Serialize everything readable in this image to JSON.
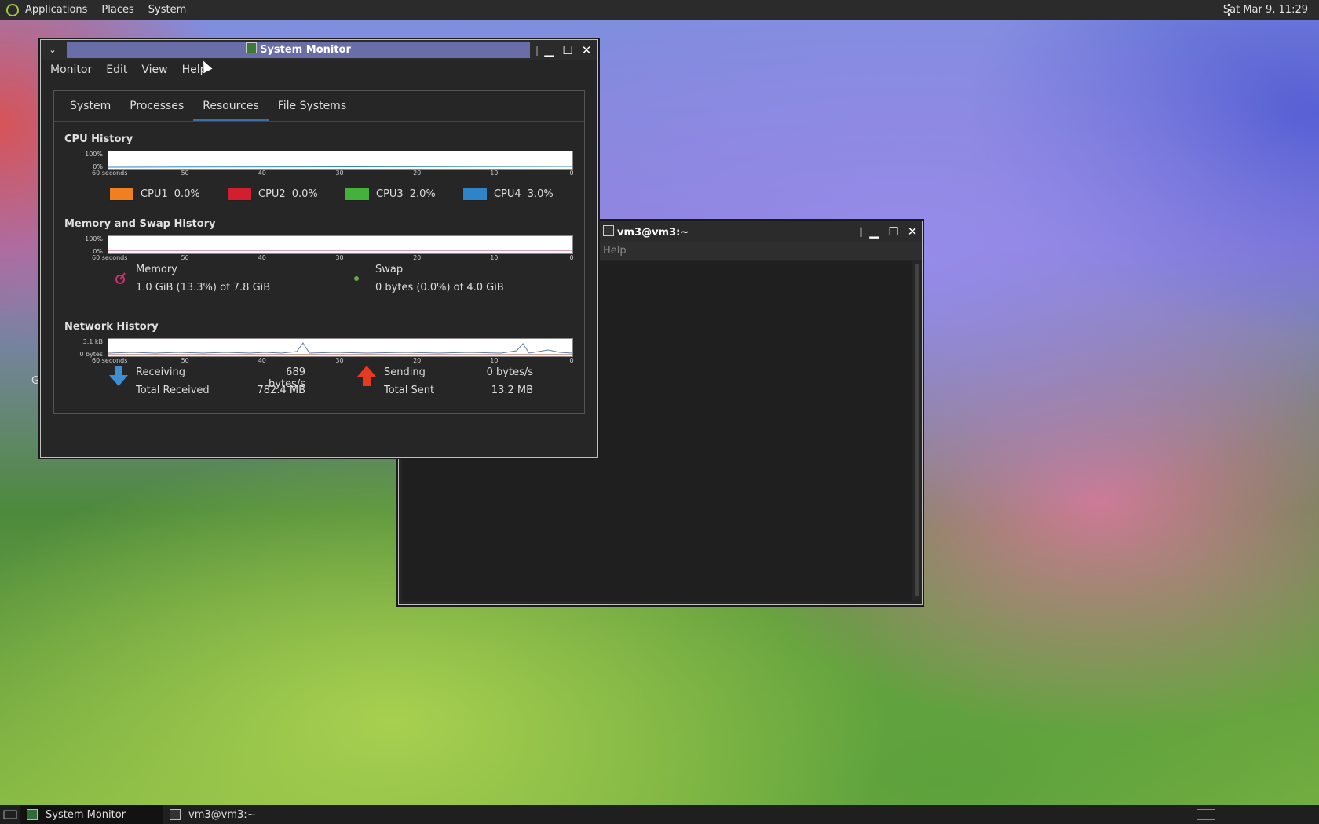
{
  "topbar": {
    "menus": [
      "Applications",
      "Places",
      "System"
    ],
    "clock": "Sat Mar  9, 11:29"
  },
  "sysmon": {
    "title": "System Monitor",
    "menus": [
      "Monitor",
      "Edit",
      "View",
      "Help"
    ],
    "tabs": [
      "System",
      "Processes",
      "Resources",
      "File Systems"
    ],
    "active_tab": "Resources",
    "cpu": {
      "title": "CPU History",
      "y_labels": [
        "100%",
        "0%"
      ],
      "x_labels": [
        "60 seconds",
        "50",
        "40",
        "30",
        "20",
        "10",
        "0"
      ],
      "legend": [
        {
          "label": "CPU1",
          "value": "0.0%",
          "color": "#f0801f"
        },
        {
          "label": "CPU2",
          "value": "0.0%",
          "color": "#d11f2f"
        },
        {
          "label": "CPU3",
          "value": "2.0%",
          "color": "#44b13a"
        },
        {
          "label": "CPU4",
          "value": "3.0%",
          "color": "#2f84c8"
        }
      ]
    },
    "memory": {
      "title": "Memory and Swap History",
      "y_labels": [
        "100%",
        "0%"
      ],
      "x_labels": [
        "60 seconds",
        "50",
        "40",
        "30",
        "20",
        "10",
        "0"
      ],
      "mem_label": "Memory",
      "mem_value": "1.0 GiB (13.3%) of 7.8 GiB",
      "swap_label": "Swap",
      "swap_value": "0 bytes (0.0%) of 4.0 GiB",
      "mem_color": "#c8336e",
      "swap_color": "#6aa84f"
    },
    "network": {
      "title": "Network History",
      "y_labels": [
        "3.1 kB",
        "0 bytes"
      ],
      "x_labels": [
        "60 seconds",
        "50",
        "40",
        "30",
        "20",
        "10",
        "0"
      ],
      "receiving_label": "Receiving",
      "receiving_value": "689 bytes/s",
      "total_received_label": "Total Received",
      "total_received_value": "782.4 MB",
      "sending_label": "Sending",
      "sending_value": "0 bytes/s",
      "total_sent_label": "Total Sent",
      "total_sent_value": "13.2 MB"
    }
  },
  "terminal": {
    "title": "vm3@vm3:~",
    "menu_help": "Help"
  },
  "taskbar": {
    "items": [
      "System Monitor",
      "vm3@vm3:~"
    ]
  },
  "desktop": {
    "partial_letter": "G"
  }
}
